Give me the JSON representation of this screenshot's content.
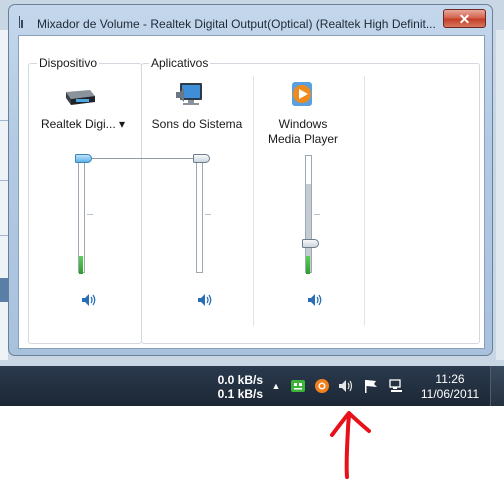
{
  "window": {
    "title": "Mixador de Volume - Realtek Digital Output(Optical) (Realtek High Definit...",
    "close_symbol": "✕"
  },
  "sections": {
    "device_label": "Dispositivo",
    "apps_label": "Aplicativos"
  },
  "columns": [
    {
      "name": "Realtek Digi... ▾",
      "icon": "speaker-device-icon",
      "volume_percent": 100,
      "meter_percent": 15,
      "mute_icon": "speaker-icon"
    },
    {
      "name": "Sons do Sistema",
      "icon": "system-sounds-icon",
      "volume_percent": 100,
      "meter_percent": 0,
      "mute_icon": "speaker-icon"
    },
    {
      "name": "Windows Media Player",
      "icon": "windows-media-player-icon",
      "volume_percent": 26,
      "meter_percent": 15,
      "mute_icon": "speaker-icon"
    }
  ],
  "taskbar": {
    "net_up": "0.0 kB/s",
    "net_down": "0.1 kB/s",
    "tray_expand": "▲",
    "time": "11:26",
    "date": "11/06/2011",
    "tray_icons": [
      "network-meter-icon",
      "orange-app-icon",
      "volume-icon",
      "action-center-flag-icon",
      "network-icon"
    ]
  },
  "annotation": {
    "color": "#e8111a",
    "shape": "hand-drawn-arrow-up"
  }
}
